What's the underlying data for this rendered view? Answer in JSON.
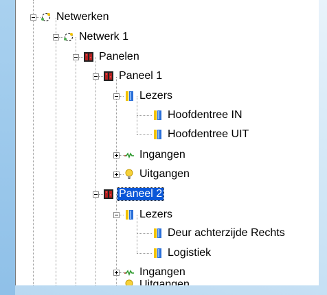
{
  "tree": {
    "root": {
      "label": "Netwerken"
    },
    "network": {
      "label": "Netwerk 1"
    },
    "panels": {
      "label": "Panelen"
    },
    "panel1": {
      "label": "Paneel 1",
      "readers": {
        "label": "Lezers",
        "items": [
          "Hoofdentree IN",
          "Hoofdentree UIT"
        ]
      },
      "inputs": {
        "label": "Ingangen"
      },
      "outputs": {
        "label": "Uitgangen"
      }
    },
    "panel2": {
      "label": "Paneel 2",
      "selected": true,
      "readers": {
        "label": "Lezers",
        "items": [
          "Deur achterzijde Rechts",
          "Logistiek"
        ]
      },
      "inputs": {
        "label": "Ingangen"
      },
      "outputs": {
        "label": "Uitgangen"
      }
    }
  },
  "colors": {
    "selection": "#0a57d8",
    "reader_blue": "#2a6fd8",
    "reader_yellow": "#f2c200",
    "bulb": "#f7d23a"
  },
  "icons": {
    "network": "network-icon",
    "panels": "panel-icon",
    "reader": "reader-icon",
    "input": "input-icon",
    "output": "bulb-icon"
  }
}
